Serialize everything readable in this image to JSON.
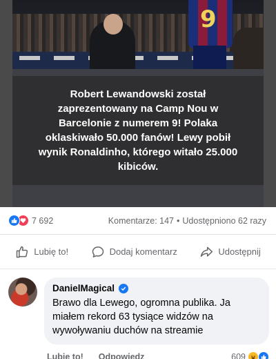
{
  "post": {
    "caption": "Robert Lewandowski został zaprezentowany na Camp Nou w Barcelonie z numerem 9! Polaka oklaskiwało 50.000 fanów! Lewy pobił wynik Ronaldinho, którego witało 25.000 kibiców.",
    "jersey_number": "9"
  },
  "stats": {
    "reaction_count": "7 692",
    "comments": "Komentarze: 147",
    "separator": "•",
    "shares": "Udostępniono 62 razy",
    "reaction_icons": [
      "like-icon",
      "love-icon"
    ]
  },
  "actions": {
    "like": "Lubię to!",
    "comment": "Dodaj komentarz",
    "share": "Udostępnij"
  },
  "comment": {
    "author": "DanielMagical",
    "verified": true,
    "text": "Brawo dla Lewego, ogromna publika. Ja miałem rekord 63 tysiące widzów na wywoływaniu duchów na streamie",
    "like_label": "Lubię to!",
    "reply_label": "Odpowiedz",
    "reaction_count": "609",
    "reaction_icons": [
      "haha-icon",
      "like-icon"
    ]
  },
  "colors": {
    "accent": "#1877f2",
    "love": "#f33e58",
    "caption_bg": "#2f2f31"
  }
}
